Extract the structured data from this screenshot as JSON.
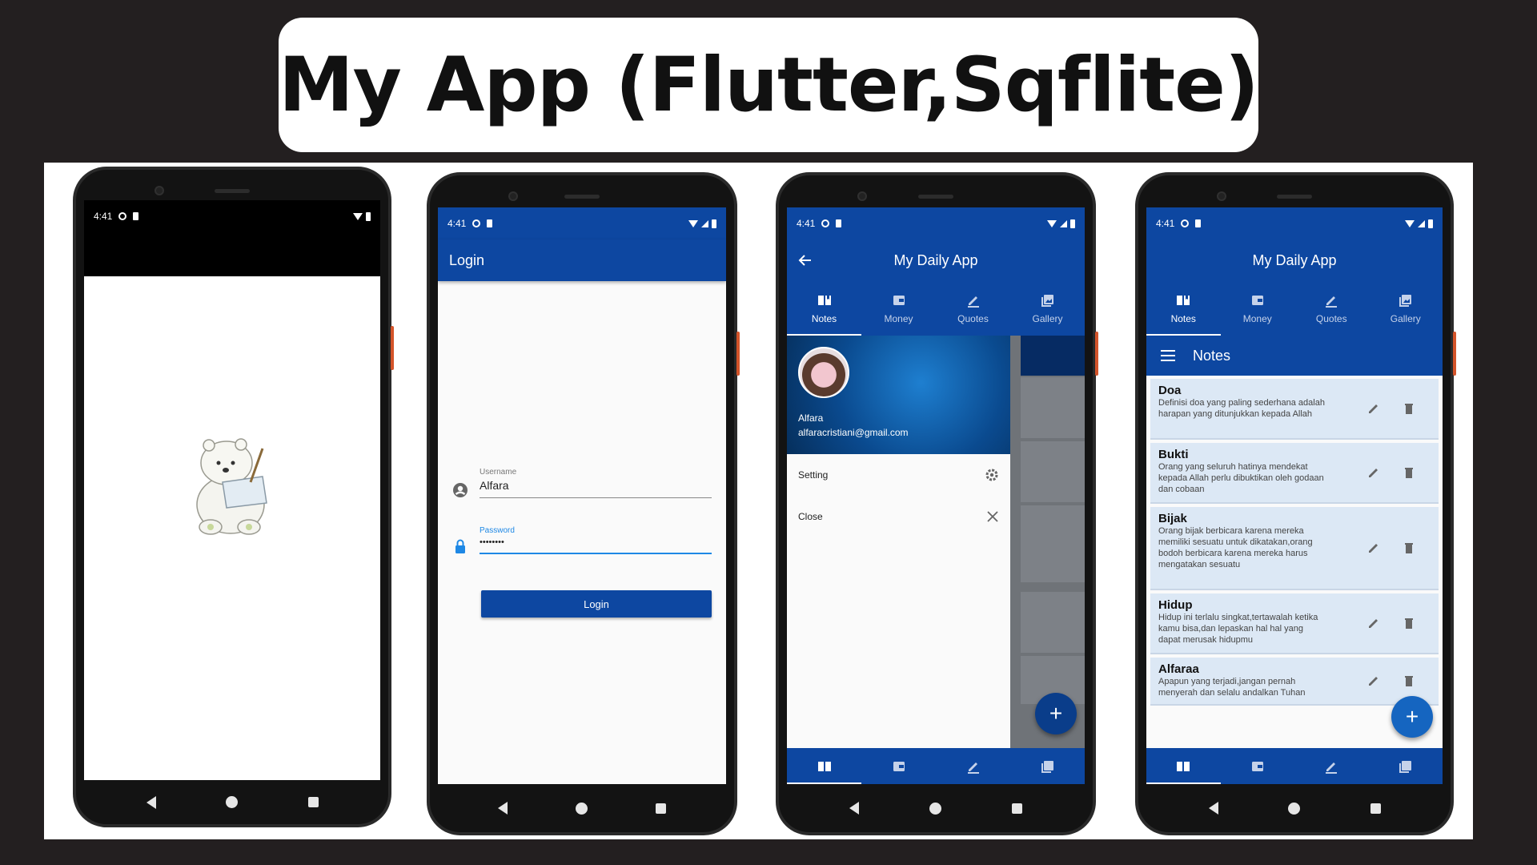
{
  "page_title": "My App (Flutter,Sqflite)",
  "status_time": "4:41",
  "tabs": [
    {
      "label": "Notes",
      "icon": "book-icon"
    },
    {
      "label": "Money",
      "icon": "wallet-icon"
    },
    {
      "label": "Quotes",
      "icon": "pen-icon"
    },
    {
      "label": "Gallery",
      "icon": "gallery-icon"
    }
  ],
  "login": {
    "appbar_title": "Login",
    "username_label": "Username",
    "username_value": "Alfara",
    "password_label": "Password",
    "password_value": "••••••••",
    "button_label": "Login"
  },
  "drawer_screen": {
    "appbar_title": "My Daily App",
    "user_name": "Alfara",
    "user_email": "alfaracristiani@gmail.com",
    "items": [
      {
        "label": "Setting",
        "icon": "gear-icon"
      },
      {
        "label": "Close",
        "icon": "close-icon"
      }
    ]
  },
  "notes_screen": {
    "appbar_title": "My Daily App",
    "section_title": "Notes",
    "fab_label": "+",
    "notes": [
      {
        "title": "Doa",
        "body": "Definisi doa yang paling sederhana adalah harapan yang ditunjukkan kepada Allah"
      },
      {
        "title": "Bukti",
        "body": "Orang yang seluruh hatinya mendekat kepada Allah perlu dibuktikan oleh godaan dan cobaan"
      },
      {
        "title": "Bijak",
        "body": "Orang bijak berbicara karena mereka memiliki sesuatu untuk dikatakan,orang bodoh berbicara karena mereka harus mengatakan sesuatu"
      },
      {
        "title": "Hidup",
        "body": "Hidup ini terlalu singkat,tertawalah ketika kamu bisa,dan lepaskan hal hal yang dapat merusak hidupmu"
      },
      {
        "title": "Alfaraa",
        "body": "Apapun yang terjadi,jangan pernah menyerah dan selalu andalkan Tuhan"
      }
    ]
  },
  "colors": {
    "primary": "#0d47a1",
    "fab": "#1565c0",
    "note_bg": "#dce8f5",
    "background": "#231f20"
  }
}
